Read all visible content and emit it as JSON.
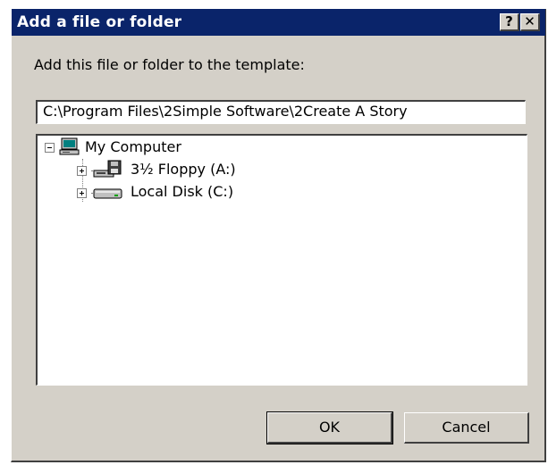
{
  "window": {
    "title": "Add a file or folder",
    "help_glyph": "?",
    "close_glyph": "✕"
  },
  "prompt": "Add this file or folder to the template:",
  "path_value": "C:\\Program Files\\2Simple Software\\2Create A Story",
  "tree": {
    "root": {
      "label": "My Computer",
      "icon": "computer-icon",
      "expanded": true
    },
    "children": [
      {
        "label": "3½ Floppy (A:)",
        "icon": "floppy-drive-icon",
        "expanded": false
      },
      {
        "label": "Local Disk (C:)",
        "icon": "hard-disk-icon",
        "expanded": false
      }
    ]
  },
  "buttons": {
    "ok_label": "OK",
    "cancel_label": "Cancel"
  },
  "colors": {
    "titlebar": "#0a246a",
    "dialog_face": "#d4d0c8"
  }
}
